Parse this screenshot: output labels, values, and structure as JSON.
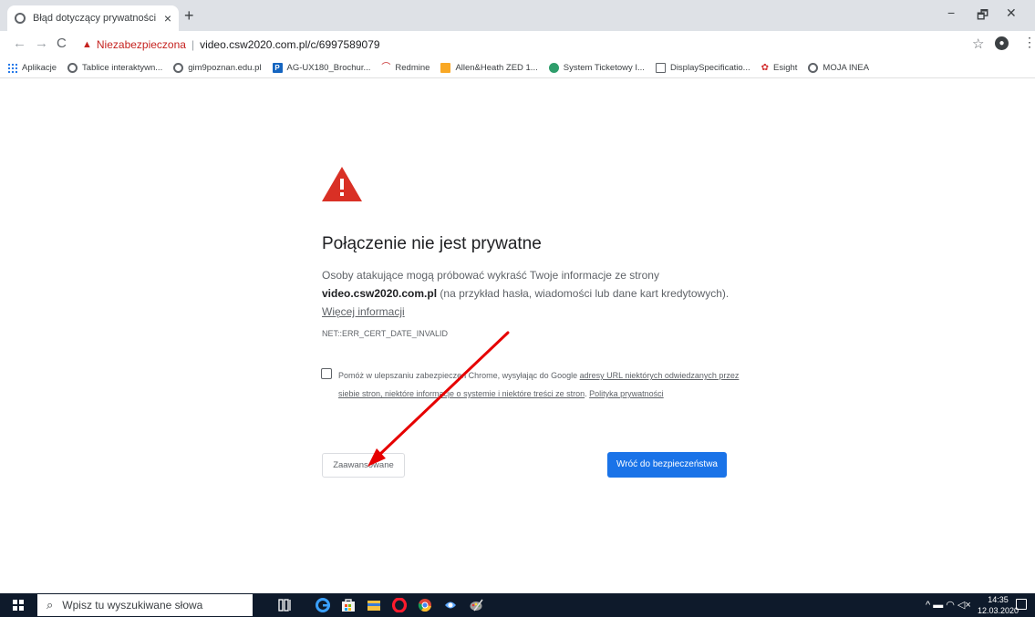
{
  "browser": {
    "tab_title": "Błąd dotyczący prywatności",
    "tab_close": "×",
    "new_tab": "+",
    "window_controls": {
      "minimize": "−",
      "restore": "🗗",
      "close": "✕"
    },
    "nav": {
      "back": "←",
      "forward": "→",
      "reload": "C"
    },
    "omnibox": {
      "warning_label": "Niezabezpieczona",
      "separator": "|",
      "url": "video.csw2020.com.pl/c/6997589079"
    },
    "bookmark_star": "☆",
    "menu": "⋮",
    "bookmarks": [
      {
        "label": "Aplikacje",
        "icon": "apps-grid-icon"
      },
      {
        "label": "Tablice interaktywn...",
        "icon": "globe-icon"
      },
      {
        "label": "gim9poznan.edu.pl",
        "icon": "globe-icon"
      },
      {
        "label": "AG-UX180_Brochur...",
        "icon": "p-icon"
      },
      {
        "label": "Redmine",
        "icon": "redmine-icon"
      },
      {
        "label": "Allen&Heath ZED 1...",
        "icon": "orange-icon"
      },
      {
        "label": "System Ticketowy I...",
        "icon": "green-icon"
      },
      {
        "label": "DisplaySpecificatio...",
        "icon": "screen-icon"
      },
      {
        "label": "Esight",
        "icon": "huawei-icon"
      },
      {
        "label": "MOJA INEA",
        "icon": "globe-icon"
      }
    ]
  },
  "interstitial": {
    "heading": "Połączenie nie jest prywatne",
    "desc_part1": "Osoby atakujące mogą próbować wykraść Twoje informacje ze strony ",
    "desc_domain": "video.csw2020.com.pl",
    "desc_part2": " (na przykład hasła, wiadomości lub dane kart kredytowych). ",
    "more_info_link": "Więcej informacji",
    "error_code": "NET::ERR_CERT_DATE_INVALID",
    "report_text": "Pomóż w ulepszaniu zabezpieczeń Chrome, wysyłając do Google ",
    "report_link": "adresy URL niektórych odwiedzanych przez siebie stron, niektóre informacje o systemie i niektóre treści ze stron",
    "report_sep": ". ",
    "privacy_link": "Polityka prywatności",
    "advanced_button": "Zaawansowane",
    "back_button": "Wróć do bezpieczeństwa"
  },
  "taskbar": {
    "search_placeholder": "Wpisz tu wyszukiwane słowa",
    "tray_icons": "^ ▬ ◠ ◁×",
    "time": "14:35",
    "date": "12.03.2020"
  },
  "colors": {
    "danger": "#d93025",
    "primary_button": "#1a73e8",
    "annotation_arrow": "#e60000",
    "taskbar": "#0e1a2b"
  }
}
